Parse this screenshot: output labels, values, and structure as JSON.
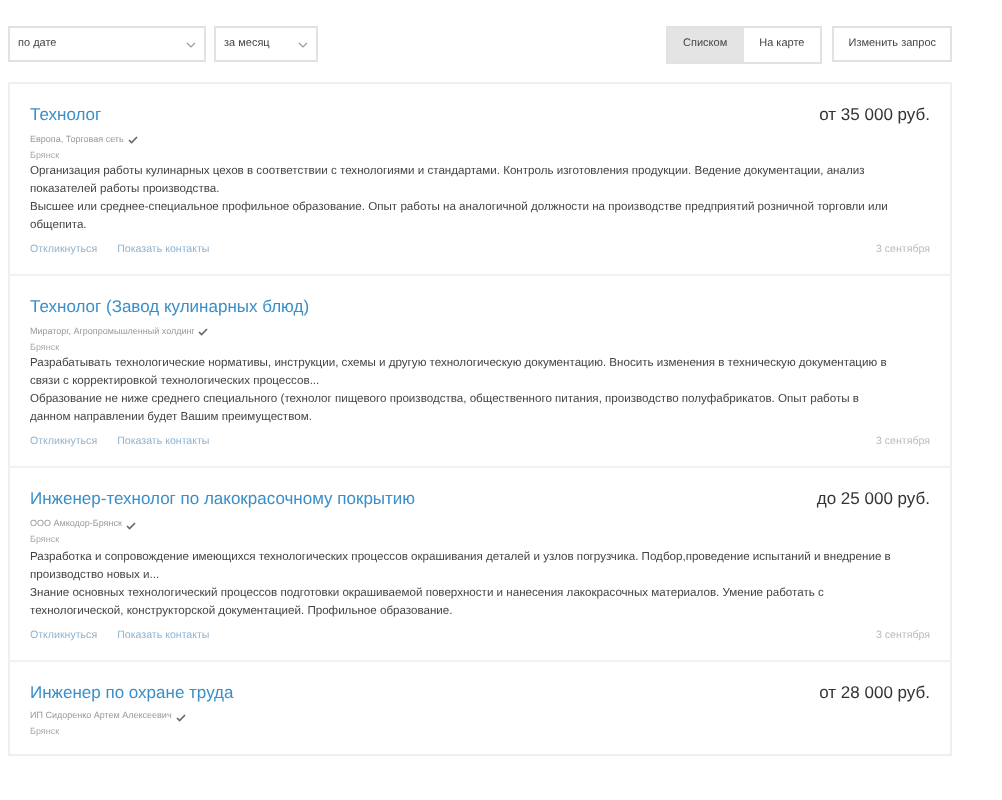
{
  "filters": [
    {
      "value": "по дате"
    },
    {
      "value": "за месяц"
    }
  ],
  "view_tabs": [
    {
      "label": "Списком",
      "selected": true
    },
    {
      "label": "На карте",
      "selected": false
    }
  ],
  "change_query_button": "Изменить запрос",
  "vacancies": [
    {
      "title": "Технолог",
      "salary": "от 35 000 руб.",
      "company": "Европа, Торговая сеть",
      "verified": true,
      "city": "Брянск",
      "duties": "Организация работы кулинарных цехов в соответствии с технологиями и стандартами. Контроль изготовления продукции. Ведение документации, анализ показателей работы производства.",
      "requirements": "Высшее или среднее-специальное профильное образование. Опыт работы на аналогичной должности на производстве предприятий розничной торговли или общепита.",
      "actions": [
        "Откликнуться",
        "Показать контакты"
      ],
      "date": "3 сентября"
    },
    {
      "title": "Технолог (Завод кулинарных блюд)",
      "company": "Мираторг, Агропромышленный холдинг",
      "verified": true,
      "city": "Брянск",
      "duties": "Разрабатывать технологические нормативы, инструкции, схемы и другую технологическую документацию. Вносить изменения в техническую документацию в связи с корректировкой технологических процессов...",
      "requirements": "Образование не ниже среднего специального (технолог пищевого производства, общественного питания, производство полуфабрикатов. Опыт работы в данном направлении будет Вашим преимуществом.",
      "actions": [
        "Откликнуться",
        "Показать контакты"
      ],
      "date": "3 сентября"
    },
    {
      "title": "Инженер-технолог по лакокрасочному покрытию",
      "salary": "до 25 000 руб.",
      "company": "ООО Амкодор-Брянск",
      "verified": true,
      "city": "Брянск",
      "duties": "Разработка и сопровождение имеющихся технологических процессов окрашивания деталей и узлов погрузчика. Подбор,проведение испытаний и внедрение в производство новых и...",
      "requirements": "Знание основных технологический процессов подготовки окрашиваемой поверхности и нанесения лакокрасочных материалов. Умение работать с технологической, конструкторской документацией. Профильное образование.",
      "actions": [
        "Откликнуться",
        "Показать контакты"
      ],
      "date": "3 сентября"
    },
    {
      "title": "Инженер по охране труда",
      "salary": "от 28 000 руб.",
      "company": "ИП Сидоренко Артем Алексеевич",
      "verified": true,
      "city": "Брянск"
    }
  ]
}
